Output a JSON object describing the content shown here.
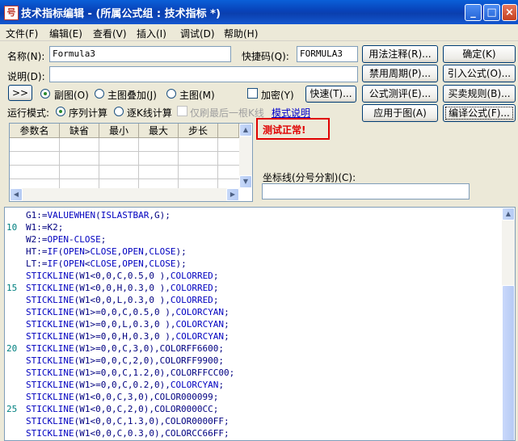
{
  "window": {
    "title": "技术指标编辑 - (所属公式组 : 技术指标 *)",
    "icon_text": "号"
  },
  "menu": [
    "文件(F)",
    "编辑(E)",
    "查看(V)",
    "插入(I)",
    "调试(D)",
    "帮助(H)"
  ],
  "form": {
    "name_label": "名称(N):",
    "name_value": "Formula3",
    "shortcut_label": "快捷码(Q):",
    "shortcut_value": "FORMULA3",
    "desc_label": "说明(D):",
    "desc_value": ""
  },
  "buttons": {
    "usage_note": "用法注释(R)...",
    "ok": "确定(K)",
    "disable_period": "禁用周期(P)...",
    "import": "引入公式(O)...",
    "test": "公式测评(E)...",
    "trade_rules": "买卖规则(B)...",
    "apply_chart": "应用于图(A)",
    "compile": "编译公式(F)...",
    "expand": ">>",
    "quick": "快速(T)...",
    "mode_help": "模式说明"
  },
  "display_options": {
    "sub_chart": "副图(O)",
    "main_overlay": "主图叠加(J)",
    "main_chart": "主图(M)",
    "selected": "副图(O)",
    "encrypt": "加密(Y)",
    "encrypt_checked": false
  },
  "run_mode": {
    "label": "运行模式:",
    "sequential": "序列计算",
    "per_bar": "逐K线计算",
    "selected": "序列计算",
    "refresh_last": "仅刷最后一根K线"
  },
  "param_table": {
    "columns": [
      "参数名",
      "缺省",
      "最小",
      "最大",
      "步长"
    ]
  },
  "status": {
    "text": "测试正常!",
    "color": "#e00000"
  },
  "axis_line": {
    "label": "坐标线(分号分割)(C):",
    "value": ""
  },
  "code": [
    {
      "n": "",
      "t": "G1:=VALUEWHEN(ISLASTBAR,G);"
    },
    {
      "n": "10",
      "t": "W1:=K2;"
    },
    {
      "n": "",
      "t": "W2:=OPEN-CLOSE;"
    },
    {
      "n": "",
      "t": "HT:=IF(OPEN>CLOSE,OPEN,CLOSE);"
    },
    {
      "n": "",
      "t": "LT:=IF(OPEN<CLOSE,OPEN,CLOSE);"
    },
    {
      "n": "",
      "t": "STICKLINE(W1<0,0,C,0.5,0 ),COLORRED;"
    },
    {
      "n": "15",
      "t": "STICKLINE(W1<0,0,H,0.3,0 ),COLORRED;"
    },
    {
      "n": "",
      "t": "STICKLINE(W1<0,0,L,0.3,0 ),COLORRED;"
    },
    {
      "n": "",
      "t": "STICKLINE(W1>=0,0,C,0.5,0 ),COLORCYAN;"
    },
    {
      "n": "",
      "t": "STICKLINE(W1>=0,0,L,0.3,0 ),COLORCYAN;"
    },
    {
      "n": "",
      "t": "STICKLINE(W1>=0,0,H,0.3,0 ),COLORCYAN;"
    },
    {
      "n": "20",
      "t": "STICKLINE(W1>=0,0,C,3,0),COLORFF6600;"
    },
    {
      "n": "",
      "t": "STICKLINE(W1>=0,0,C,2,0),COLORFF9900;"
    },
    {
      "n": "",
      "t": "STICKLINE(W1>=0,0,C,1.2,0),COLORFFCC00;"
    },
    {
      "n": "",
      "t": "STICKLINE(W1>=0,0,C,0.2,0),COLORCYAN;"
    },
    {
      "n": "",
      "t": "STICKLINE(W1<0,0,C,3,0),COLOR000099;"
    },
    {
      "n": "25",
      "t": "STICKLINE(W1<0,0,C,2,0),COLOR0000CC;"
    },
    {
      "n": "",
      "t": "STICKLINE(W1<0,0,C,1.3,0),COLOR0000FF;"
    },
    {
      "n": "",
      "t": "STICKLINE(W1<0,0,C,0.3,0),COLORCC66FF;"
    }
  ],
  "colors": {
    "keyword": "#0000c0",
    "plain": "#000080",
    "line_number": "#008080"
  }
}
